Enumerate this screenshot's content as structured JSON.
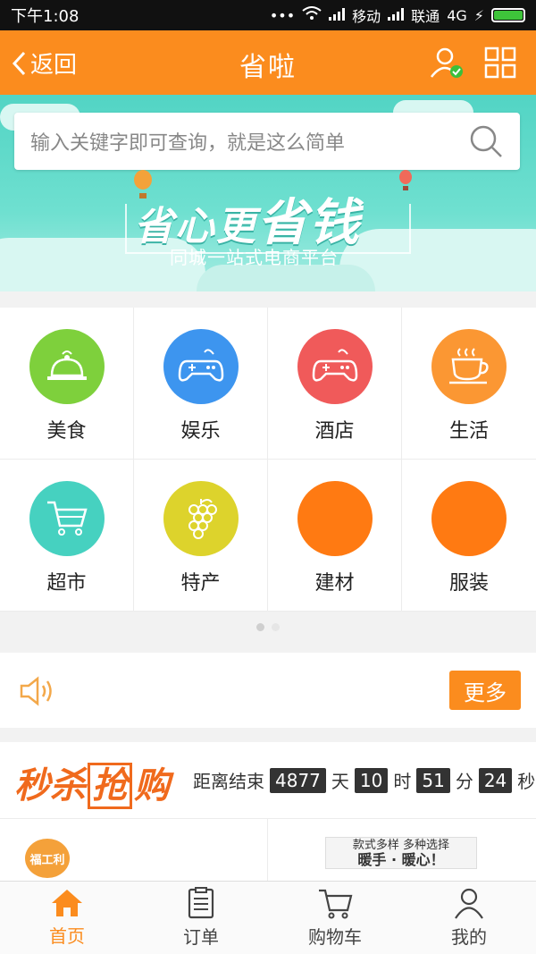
{
  "status_bar": {
    "time": "下午1:08",
    "carrier1": "移动",
    "carrier2": "联通",
    "network": "4G"
  },
  "header": {
    "back_label": "返回",
    "title": "省啦",
    "user_icon": "user-check-icon",
    "grid_icon": "grid-icon"
  },
  "banner": {
    "search_placeholder": "输入关键字即可查询，就是这么简单",
    "slogan_part1": "省心更",
    "slogan_part2": "省钱",
    "subtitle": "同城一站式电商平台"
  },
  "categories": [
    {
      "label": "美食",
      "icon": "food-cloche-icon",
      "color": "#7ed03c"
    },
    {
      "label": "娱乐",
      "icon": "gamepad-icon",
      "color": "#3d95ef"
    },
    {
      "label": "酒店",
      "icon": "gamepad-icon",
      "color": "#f05a5a"
    },
    {
      "label": "生活",
      "icon": "coffee-cup-icon",
      "color": "#fb9733"
    },
    {
      "label": "超市",
      "icon": "shopping-cart-icon",
      "color": "#46d1c0"
    },
    {
      "label": "特产",
      "icon": "grapes-icon",
      "color": "#ddd32c"
    },
    {
      "label": "建材",
      "icon": "",
      "color": "#ff7a12"
    },
    {
      "label": "服装",
      "icon": "",
      "color": "#ff7a12"
    }
  ],
  "pager": {
    "total": 2,
    "current": 1
  },
  "notice": {
    "more_label": "更多"
  },
  "flash_sale": {
    "title_part1": "秒杀",
    "title_part2": "抢",
    "title_part3": "购",
    "countdown_prefix": "距离结束",
    "days": "4877",
    "days_unit": "天",
    "hours": "10",
    "hours_unit": "时",
    "minutes": "51",
    "minutes_unit": "分",
    "seconds": "24",
    "seconds_unit": "秒"
  },
  "products": {
    "p1_logo_text": "福工利",
    "p2_line1": "款式多样 多种选择",
    "p2_line2": "暖手 · 暖心！"
  },
  "bottom_nav": [
    {
      "label": "首页",
      "icon": "home-icon",
      "active": true
    },
    {
      "label": "订单",
      "icon": "order-list-icon",
      "active": false
    },
    {
      "label": "购物车",
      "icon": "cart-icon",
      "active": false
    },
    {
      "label": "我的",
      "icon": "person-icon",
      "active": false
    }
  ],
  "colors": {
    "brand_orange": "#fb8c1e",
    "banner_teal": "#52d4c4"
  }
}
